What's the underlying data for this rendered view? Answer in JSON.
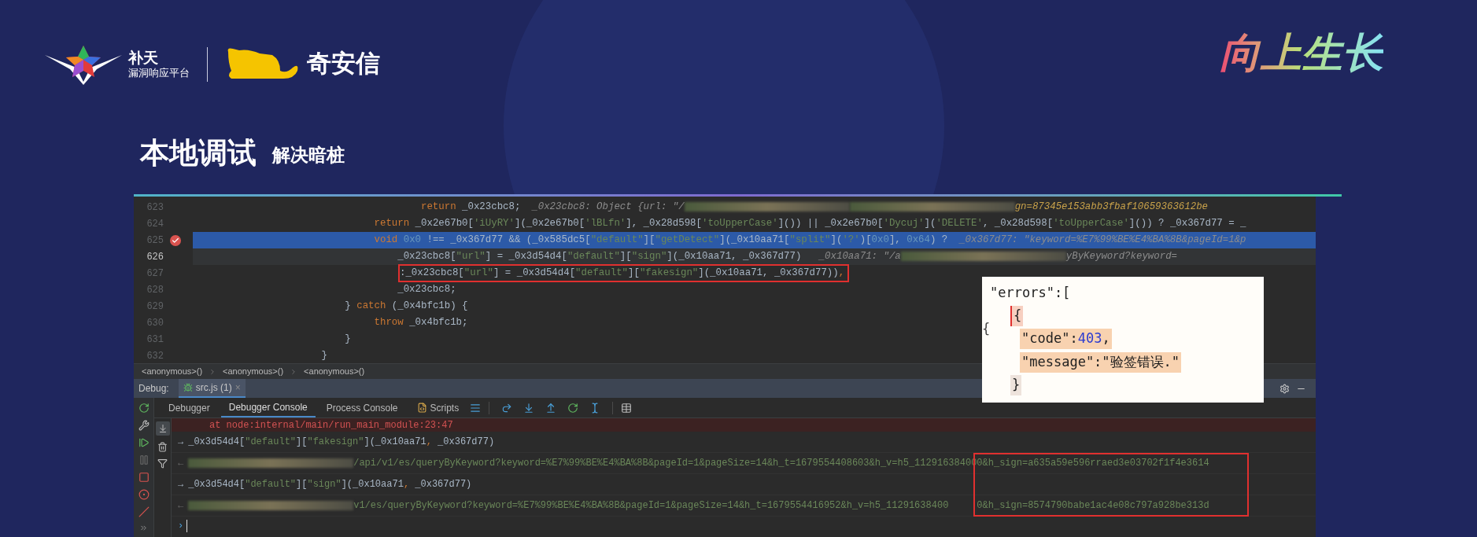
{
  "header": {
    "brand_name": "补天",
    "brand_subtitle": "漏洞响应平台",
    "partner_name": "奇安信",
    "slogan": "向上生长"
  },
  "title": {
    "main": "本地调试",
    "subtitle": "解决暗桩"
  },
  "editor": {
    "lines": [
      {
        "number": "623",
        "breakpoint": false,
        "selected": false,
        "current": false,
        "annotated": false,
        "segments": [
          {
            "kind": "keyword",
            "text": "                                       return"
          },
          {
            "kind": "plain",
            "text": " _0x23cbc8;"
          },
          {
            "kind": "inline_value",
            "text": "  _0x23cbc8: Object {url: \"/"
          },
          {
            "kind": "redacted"
          },
          {
            "kind": "redacted"
          },
          {
            "kind": "inline_tail",
            "text": "gn=87345e153abb3fbaf10659363612be"
          }
        ]
      },
      {
        "number": "624",
        "breakpoint": false,
        "selected": false,
        "current": false,
        "annotated": false,
        "segments": [
          {
            "kind": "keyword",
            "text": "                               return"
          },
          {
            "kind": "plain",
            "text": " _0x2e67b0["
          },
          {
            "kind": "string",
            "text": "'iUyRY'"
          },
          {
            "kind": "plain",
            "text": "](_0x2e67b0["
          },
          {
            "kind": "string",
            "text": "'lBLfn'"
          },
          {
            "kind": "plain",
            "text": "], _0x28d598["
          },
          {
            "kind": "string",
            "text": "'toUpperCase'"
          },
          {
            "kind": "plain",
            "text": "]()) || _0x2e67b0["
          },
          {
            "kind": "string",
            "text": "'Dycuj'"
          },
          {
            "kind": "plain",
            "text": "]("
          },
          {
            "kind": "string",
            "text": "'DELETE'"
          },
          {
            "kind": "plain",
            "text": ", _0x28d598["
          },
          {
            "kind": "string",
            "text": "'toUpperCase'"
          },
          {
            "kind": "plain",
            "text": "]()) ? _0x367d77 = _"
          }
        ]
      },
      {
        "number": "625",
        "breakpoint": true,
        "selected": true,
        "current": false,
        "annotated": false,
        "segments": [
          {
            "kind": "keyword",
            "text": "                               void"
          },
          {
            "kind": "number",
            "text": " 0x0"
          },
          {
            "kind": "plain",
            "text": " !== _0x367d77 && (_0x585dc5["
          },
          {
            "kind": "string",
            "text": "\"default\""
          },
          {
            "kind": "plain",
            "text": "]["
          },
          {
            "kind": "string",
            "text": "\"getDetect\""
          },
          {
            "kind": "plain",
            "text": "](_0x10aa71["
          },
          {
            "kind": "string",
            "text": "\"split\""
          },
          {
            "kind": "plain",
            "text": "]("
          },
          {
            "kind": "string",
            "text": "'?'"
          },
          {
            "kind": "plain",
            "text": ")["
          },
          {
            "kind": "number",
            "text": "0x0"
          },
          {
            "kind": "plain",
            "text": "], "
          },
          {
            "kind": "number",
            "text": "0x64"
          },
          {
            "kind": "plain",
            "text": ") ?  "
          },
          {
            "kind": "inline_value",
            "text": "_0x367d77: \"keyword=%E7%99%BE%E4%BA%8B&pageId=1&p"
          }
        ]
      },
      {
        "number": "626",
        "breakpoint": false,
        "selected": false,
        "current": true,
        "annotated": false,
        "segments": [
          {
            "kind": "plain",
            "text": "                                   _0x23cbc8["
          },
          {
            "kind": "string",
            "text": "\"url\""
          },
          {
            "kind": "plain",
            "text": "] = _0x3d54d4["
          },
          {
            "kind": "string",
            "text": "\"default\""
          },
          {
            "kind": "plain",
            "text": "]["
          },
          {
            "kind": "string",
            "text": "\"sign\""
          },
          {
            "kind": "plain",
            "text": "](_0x10aa71, _0x367d77)"
          },
          {
            "kind": "inline_value",
            "text": "   _0x10aa71: \"/a"
          },
          {
            "kind": "redacted"
          },
          {
            "kind": "inline_value",
            "text": "yByKeyword?keyword="
          }
        ]
      },
      {
        "number": "627",
        "breakpoint": false,
        "selected": false,
        "current": false,
        "annotated": true,
        "segments": [
          {
            "kind": "plain",
            "text": ":_0x23cbc8["
          },
          {
            "kind": "string",
            "text": "\"url\""
          },
          {
            "kind": "plain",
            "text": "] = _0x3d54d4["
          },
          {
            "kind": "string",
            "text": "\"default\""
          },
          {
            "kind": "plain",
            "text": "]["
          },
          {
            "kind": "string",
            "text": "\"fakesign\""
          },
          {
            "kind": "plain",
            "text": "](_0x10aa71, _0x367d77))"
          },
          {
            "kind": "keyword",
            "text": ","
          }
        ]
      },
      {
        "number": "628",
        "breakpoint": false,
        "selected": false,
        "current": false,
        "annotated": false,
        "segments": [
          {
            "kind": "plain",
            "text": "                                   _0x23cbc8;"
          }
        ]
      },
      {
        "number": "629",
        "breakpoint": false,
        "selected": false,
        "current": false,
        "annotated": false,
        "segments": [
          {
            "kind": "plain",
            "text": "                          } "
          },
          {
            "kind": "keyword",
            "text": "catch"
          },
          {
            "kind": "plain",
            "text": " (_0x4bfc1b) {"
          }
        ]
      },
      {
        "number": "630",
        "breakpoint": false,
        "selected": false,
        "current": false,
        "annotated": false,
        "segments": [
          {
            "kind": "keyword",
            "text": "                               throw"
          },
          {
            "kind": "plain",
            "text": " _0x4bfc1b;"
          }
        ]
      },
      {
        "number": "631",
        "breakpoint": false,
        "selected": false,
        "current": false,
        "annotated": false,
        "segments": [
          {
            "kind": "plain",
            "text": "                          }"
          }
        ]
      },
      {
        "number": "632",
        "breakpoint": false,
        "selected": false,
        "current": false,
        "annotated": false,
        "segments": [
          {
            "kind": "plain",
            "text": "                      }"
          }
        ]
      }
    ]
  },
  "breadcrumbs": [
    "<anonymous>()",
    "<anonymous>()",
    "<anonymous>()"
  ],
  "debug_header": {
    "label": "Debug:",
    "session": {
      "label": "src.js (1)",
      "close": "×"
    }
  },
  "toolbar_tabs": [
    {
      "label": "Debugger",
      "selected": false,
      "kind": "text"
    },
    {
      "label": "Debugger Console",
      "selected": true,
      "kind": "text"
    },
    {
      "label": "Process Console",
      "selected": false,
      "kind": "text"
    },
    {
      "label": "Scripts",
      "selected": false,
      "kind": "icon"
    }
  ],
  "console": [
    {
      "kind": "error",
      "text": "at node:internal/main/run_main_module:23:47"
    },
    {
      "kind": "input",
      "prompt": "→",
      "segments": [
        {
          "kind": "plain",
          "text": "_0x3d54d4["
        },
        {
          "kind": "string",
          "text": "\"default\""
        },
        {
          "kind": "plain",
          "text": "]["
        },
        {
          "kind": "string",
          "text": "\"fakesign\""
        },
        {
          "kind": "plain",
          "text": "](_0x10aa71"
        },
        {
          "kind": "keyword",
          "text": ", "
        },
        {
          "kind": "plain",
          "text": "_0x367d77)"
        }
      ]
    },
    {
      "kind": "output",
      "prompt": "←",
      "text": "/api/v1/es/queryByKeyword?keyword=%E7%99%BE%E4%BA%8B&pageId=1&pageSize=14&h_t=1679554408603&h_v=h5_11291638400",
      "signature": "0&h_sign=a635a59e596rraed3e03702f1f4e3614"
    },
    {
      "kind": "input",
      "prompt": "→",
      "segments": [
        {
          "kind": "plain",
          "text": "_0x3d54d4["
        },
        {
          "kind": "string",
          "text": "\"default\""
        },
        {
          "kind": "plain",
          "text": "]["
        },
        {
          "kind": "string",
          "text": "\"sign\""
        },
        {
          "kind": "plain",
          "text": "](_0x10aa71"
        },
        {
          "kind": "keyword",
          "text": ", "
        },
        {
          "kind": "plain",
          "text": "_0x367d77)"
        }
      ]
    },
    {
      "kind": "output",
      "prompt": "←",
      "text": "v1/es/queryByKeyword?keyword=%E7%99%BE%E4%BA%8B&pageId=1&pageSize=14&h_t=1679554416952&h_v=h5_11291638400",
      "signature": "0&h_sign=8574790babe1ac4e08c797a928be313d"
    },
    {
      "kind": "prompt",
      "prompt": "›"
    }
  ],
  "error_snippet": {
    "header": "\"errors\":[",
    "stray_brace": "{",
    "open_brace": "{",
    "fields": [
      {
        "key": "\"code\":",
        "value": "403",
        "kind": "number",
        "suffix": ","
      },
      {
        "key": "\"message\":",
        "value": "\"验签错误.\"",
        "kind": "string"
      }
    ],
    "close_brace": "}"
  }
}
